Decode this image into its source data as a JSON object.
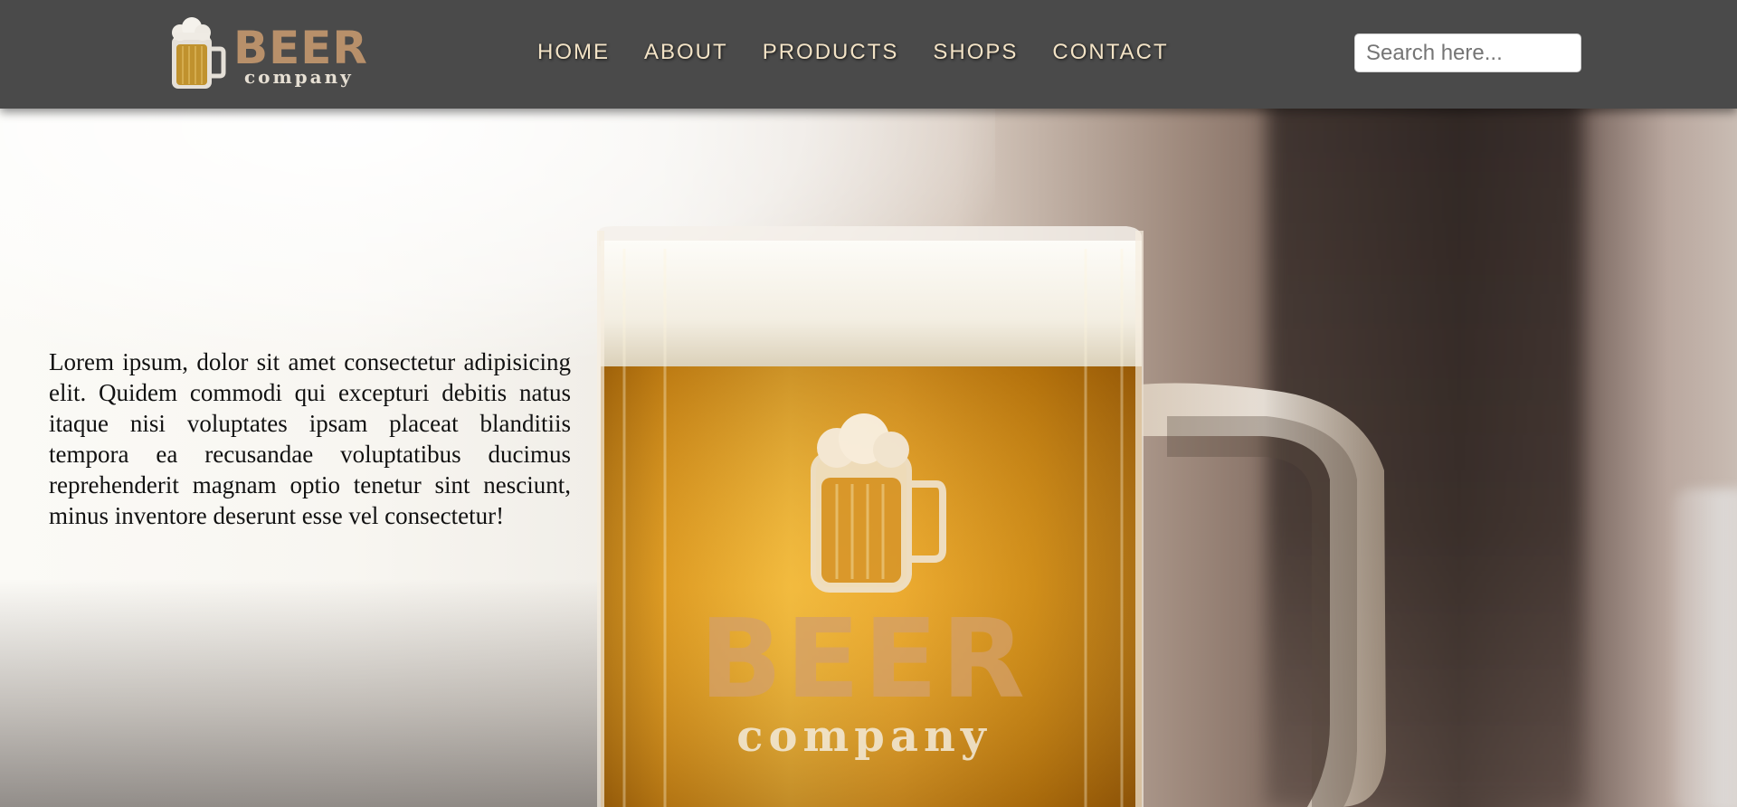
{
  "brand": {
    "name": "BEER",
    "tagline": "company"
  },
  "nav": {
    "items": [
      {
        "label": "HOME"
      },
      {
        "label": "ABOUT"
      },
      {
        "label": "PRODUCTS"
      },
      {
        "label": "SHOPS"
      },
      {
        "label": "CONTACT"
      }
    ]
  },
  "search": {
    "placeholder": "Search here...",
    "value": ""
  },
  "hero": {
    "text": "Lorem ipsum, dolor sit amet consectetur adipisicing elit. Quidem commodi qui excepturi debitis natus itaque nisi voluptates ipsam placeat blanditiis tempora ea recusandae voluptatibus ducimus reprehenderit magnam optio tenetur sint nesciunt, minus inventore deserunt esse vel consectetur!",
    "mug_brand": "BEER",
    "mug_tagline": "company"
  },
  "colors": {
    "header_bg": "#4a4a4a",
    "nav_text": "#f3e3c6",
    "brand_tan": "#b8906a",
    "beer_amber": "#d9961c"
  }
}
